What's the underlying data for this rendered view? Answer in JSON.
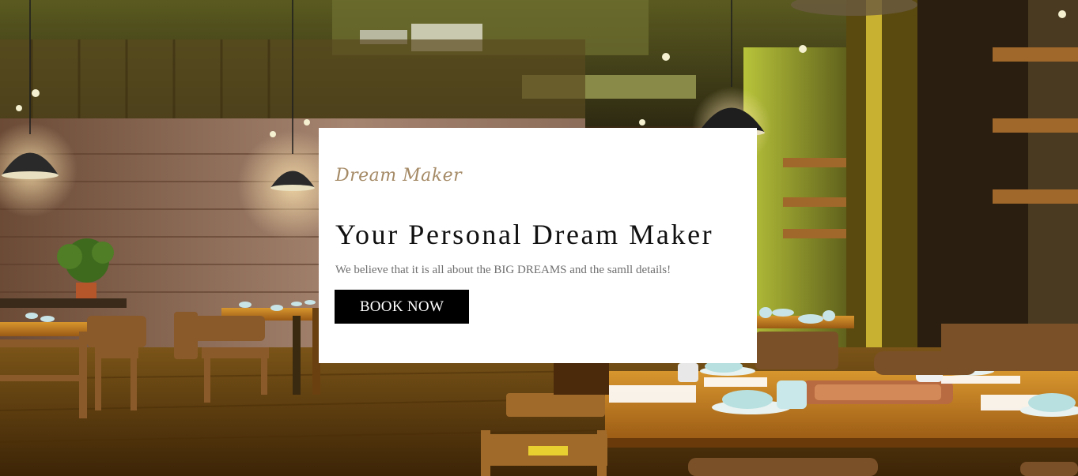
{
  "hero": {
    "script_title": "Dream Maker",
    "headline": "Your Personal Dream Maker",
    "subtitle": "We believe that it is all about the BIG DREAMS and the samll details!",
    "cta_label": "BOOK NOW"
  },
  "colors": {
    "card_background": "#ffffff",
    "script_title": "#a58a66",
    "headline": "#111111",
    "subtitle": "#6f6f6f",
    "button_background": "#000000",
    "button_text": "#ffffff"
  },
  "background_image": {
    "subject": "restaurant-interior-photo"
  }
}
